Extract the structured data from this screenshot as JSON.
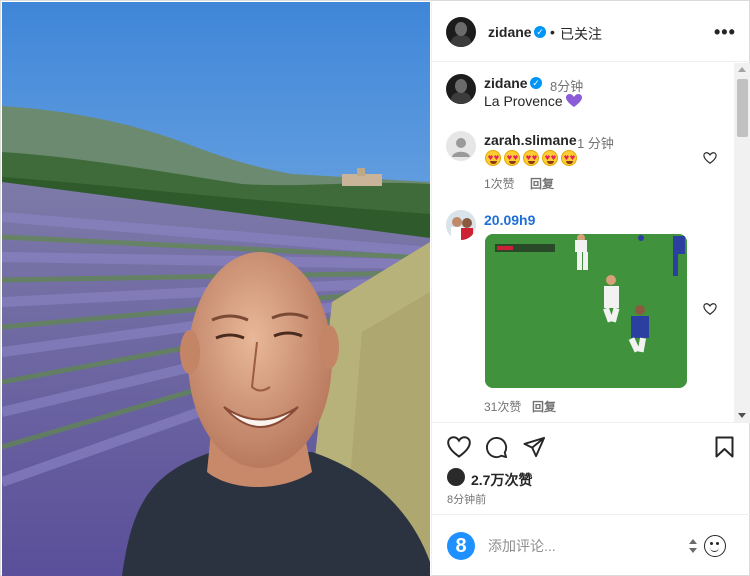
{
  "post": {
    "author": "zidane",
    "follow_state": "已关注",
    "separator": "•",
    "more": "•••"
  },
  "caption": {
    "author": "zidane",
    "time": "8分钟",
    "text": "La Provence"
  },
  "comments": [
    {
      "author": "zarah.slimane",
      "time": "1 分钟",
      "likes": "1次赞",
      "reply": "回复"
    },
    {
      "author": "20.09h9",
      "likes": "31次赞",
      "reply": "回复"
    }
  ],
  "likes": {
    "count": "2.7万次赞",
    "posted": "8分钟前"
  },
  "comment_bar": {
    "badge": "8",
    "placeholder": "添加评论..."
  },
  "colors": {
    "verified": "#0095f6",
    "heart_emoji": "#8a5cd6",
    "badge": "#1e90ff"
  }
}
